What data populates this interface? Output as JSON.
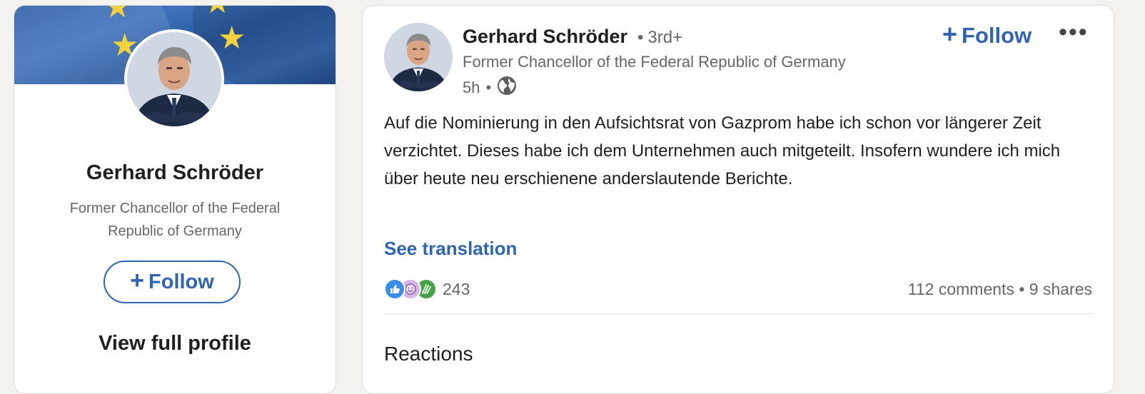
{
  "profile_card": {
    "name": "Gerhard Schröder",
    "headline": "Former Chancellor of the Federal Republic of Germany",
    "follow_label": "Follow",
    "view_profile_label": "View full profile"
  },
  "post": {
    "author_name": "Gerhard Schröder",
    "degree": "3rd+",
    "author_headline": "Former Chancellor of the Federal Republic of Germany",
    "time": "5h",
    "visibility_icon": "globe-icon",
    "follow_label": "Follow",
    "more_label": "•••",
    "text": "Auf die Nominierung in den Aufsichtsrat von Gazprom habe ich schon vor längerer Zeit verzichtet. Dieses habe ich dem Unternehmen auch mitgeteilt. Insofern wundere ich mich über heute neu erschienene anderslautende Berichte.",
    "see_translation": "See translation",
    "reaction_count": "243",
    "comments": "112 comments",
    "shares": "9 shares",
    "reaction_icons": [
      "like-icon",
      "funny-icon",
      "celebrate-icon"
    ],
    "reactions_heading": "Reactions"
  },
  "colors": {
    "accent": "#2e64b2",
    "text_primary": "#1f1f1f",
    "text_secondary": "#666666",
    "background": "#f3f2ef"
  }
}
